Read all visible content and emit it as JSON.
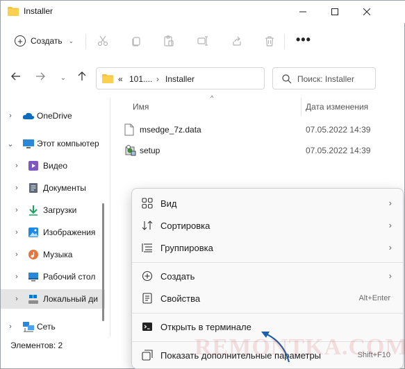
{
  "window": {
    "title": "Installer"
  },
  "titlebar": {
    "minimize_icon": "minimize-icon",
    "maximize_icon": "maximize-icon",
    "close_icon": "close-icon"
  },
  "toolbar": {
    "create_label": "Создать",
    "icons": [
      "cut-icon",
      "copy-icon",
      "paste-icon",
      "rename-icon",
      "share-icon",
      "delete-icon"
    ],
    "more_label": "•••"
  },
  "address": {
    "prefix": "«",
    "segment1": "101....",
    "separator": "›",
    "segment2": "Installer"
  },
  "search": {
    "placeholder": "Поиск: Installer"
  },
  "sidebar": {
    "items": [
      {
        "label": "OneDrive",
        "icon": "cloud-icon"
      },
      {
        "label": "Этот компьютер",
        "icon": "computer-icon"
      },
      {
        "label": "Видео",
        "icon": "video-icon"
      },
      {
        "label": "Документы",
        "icon": "documents-icon"
      },
      {
        "label": "Загрузки",
        "icon": "downloads-icon"
      },
      {
        "label": "Изображения",
        "icon": "pictures-icon"
      },
      {
        "label": "Музыка",
        "icon": "music-icon"
      },
      {
        "label": "Рабочий стол",
        "icon": "desktop-icon"
      },
      {
        "label": "Локальный ди",
        "icon": "drive-icon"
      },
      {
        "label": "Сеть",
        "icon": "network-icon"
      }
    ]
  },
  "files": {
    "columns": {
      "name": "Имя",
      "date": "Дата изменения"
    },
    "rows": [
      {
        "name": "msedge_7z.data",
        "date": "07.05.2022 14:39",
        "icon": "file-icon"
      },
      {
        "name": "setup",
        "date": "07.05.2022 14:39",
        "icon": "installer-icon"
      }
    ]
  },
  "status": {
    "items_count": "Элементов: 2"
  },
  "context_menu": {
    "items": [
      {
        "label": "Вид",
        "icon": "grid-view-icon",
        "submenu": true
      },
      {
        "label": "Сортировка",
        "icon": "sort-icon",
        "submenu": true
      },
      {
        "label": "Группировка",
        "icon": "group-icon",
        "submenu": true
      },
      {
        "label": "Создать",
        "icon": "add-icon",
        "submenu": true
      },
      {
        "label": "Свойства",
        "icon": "properties-icon",
        "shortcut": "Alt+Enter"
      },
      {
        "label": "Открыть в терминале",
        "icon": "terminal-icon"
      },
      {
        "label": "Показать дополнительные параметры",
        "icon": "more-options-icon",
        "shortcut": "Shift+F10"
      }
    ]
  },
  "watermark": {
    "text": "REMONTKA.COM"
  }
}
